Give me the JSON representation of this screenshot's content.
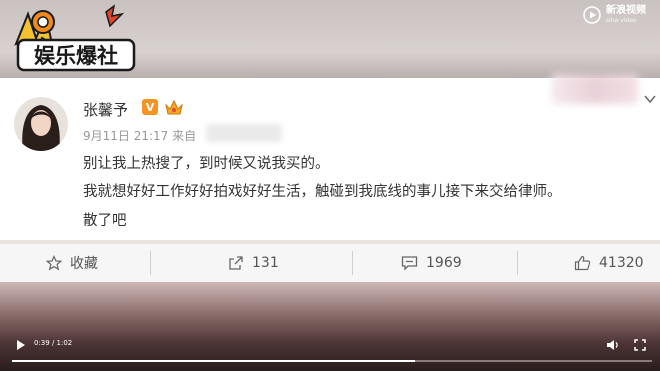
{
  "overlay": {
    "logo_text": "娱乐爆社",
    "watermark_cn": "新浪视频",
    "watermark_en": "sina video"
  },
  "post": {
    "author": "张馨予",
    "verified_badge": "V",
    "date": "9月11日",
    "time": "21:17",
    "source_prefix": "来自",
    "lines": [
      "别让我上热搜了，到时候又说我买的。",
      "我就想好好工作好好拍戏好好生活，触碰到我底线的事儿接下来交给律师。",
      "散了吧"
    ]
  },
  "actions": {
    "favorite_label": "收藏",
    "repost_count": "131",
    "comment_count": "1969",
    "like_count": "41320"
  },
  "player": {
    "time_display": "0:39 / 1:02",
    "progress_fraction": 0.629
  },
  "colors": {
    "badge": "#f79321",
    "text": "#333333",
    "meta": "#999999"
  },
  "icons": [
    "play-icon",
    "volume-icon",
    "fullscreen-icon",
    "star-icon",
    "repost-icon",
    "comment-icon",
    "like-icon",
    "chevron-down-icon",
    "crown-icon"
  ]
}
